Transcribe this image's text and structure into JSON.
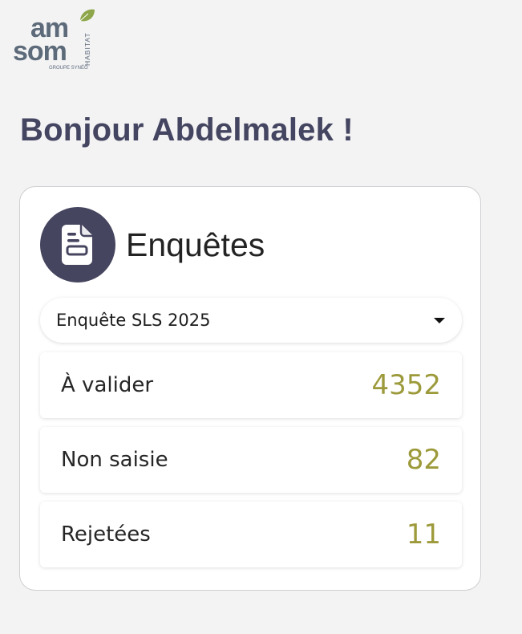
{
  "brand": {
    "logo_line1": "am",
    "logo_line2": "som",
    "logo_side": "HABITAT",
    "logo_group": "GROUPE SYNÉO",
    "colors": {
      "slate": "#5c6a79",
      "leaf": "#8da64a"
    }
  },
  "greeting": "Bonjour Abdelmalek !",
  "card": {
    "icon": "document-icon",
    "title": "Enquêtes",
    "select": {
      "value": "Enquête SLS 2025",
      "icon": "caret-down-icon"
    },
    "stats": [
      {
        "label": "À valider",
        "value": "4352"
      },
      {
        "label": "Non saisie",
        "value": "82"
      },
      {
        "label": "Rejetées",
        "value": "11"
      }
    ]
  },
  "colors": {
    "background": "#f3f3f4",
    "primary_dark": "#46455f",
    "accent_value": "#9d9a3b"
  }
}
